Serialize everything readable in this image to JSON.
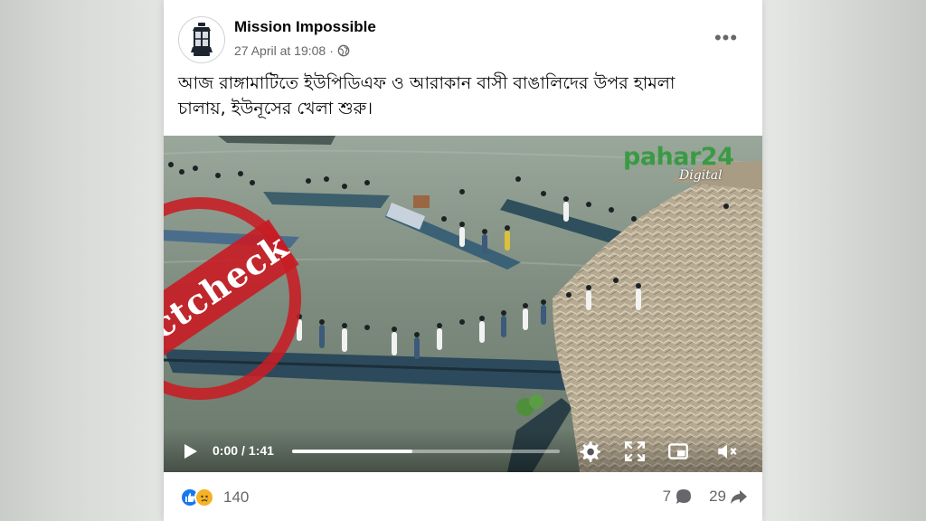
{
  "post": {
    "author": "Mission Impossible",
    "timestamp": "27 April at 19:08",
    "separator": "·",
    "privacy_icon": "globe-icon",
    "more_label": "•••",
    "text_line1": "আজ রাঙ্গামাটিতে ইউপিডিএফ ও আরাকান বাসী বাঙালিদের উপর হামলা",
    "text_line2": "চালায়, ইউনূসের খেলা শুরু।"
  },
  "overlay": {
    "stamp_text": "Factcheck",
    "stamp_color": "#c81c24",
    "watermark_main": "pahar24",
    "watermark_sub": "Digital"
  },
  "video_player": {
    "current_time": "0:00",
    "duration": "1:41",
    "time_separator": "/",
    "progress": 0.0,
    "buffered": 0.45,
    "icons": [
      "play-icon",
      "gear-icon",
      "fullscreen-icon",
      "pip-icon",
      "volume-icon"
    ]
  },
  "engagement": {
    "reaction_icons": [
      "like-icon",
      "sad-icon"
    ],
    "reaction_count": "140",
    "comment_count": "7",
    "share_count": "29",
    "like_color": "#1877f2",
    "sad_color": "#f7b125"
  },
  "colors": {
    "card_bg": "#ffffff",
    "text_primary": "#050505",
    "text_secondary": "#65676b"
  }
}
